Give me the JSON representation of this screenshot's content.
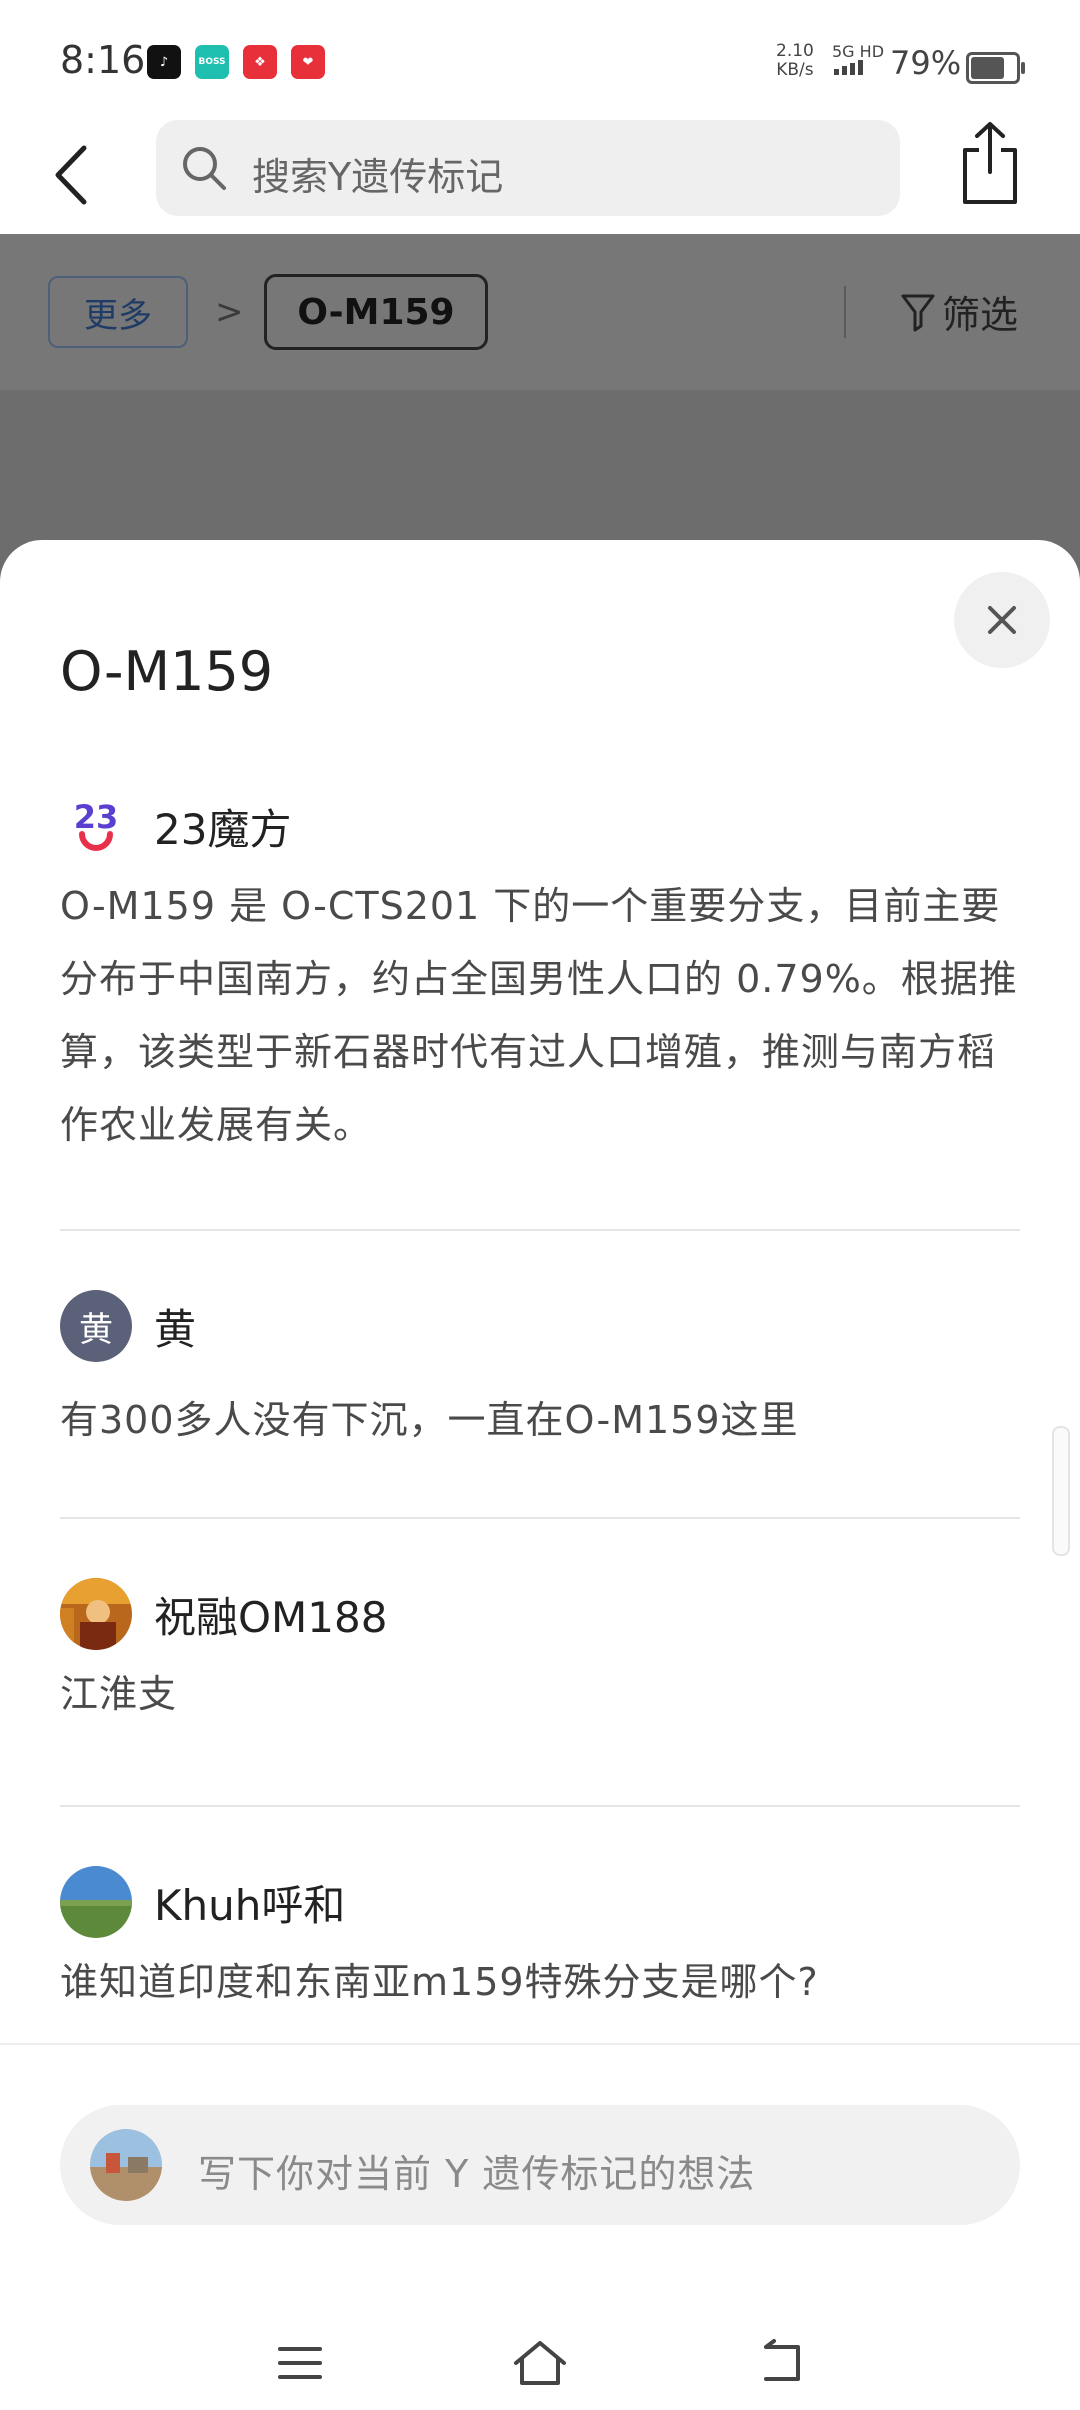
{
  "status_bar": {
    "time": "8:16",
    "app_icons": [
      {
        "name": "tiktok-icon",
        "color": "#111111",
        "label": "♪"
      },
      {
        "name": "boss-icon",
        "color": "#1fbfb0",
        "label": "BOSS"
      },
      {
        "name": "app-red-icon-1",
        "color": "#e8303a",
        "label": "❖"
      },
      {
        "name": "app-red-icon-2",
        "color": "#e8303a",
        "label": "❤"
      }
    ],
    "net_speed": "2.10",
    "net_unit": "KB/s",
    "signal": "5G HD",
    "battery": "79%",
    "battery_level": 0.79
  },
  "nav": {
    "search_placeholder": "搜索Y遗传标记"
  },
  "filter_bar": {
    "more": "更多",
    "separator": ">",
    "current": "O-M159",
    "filter": "筛选"
  },
  "sheet": {
    "title": "O-M159",
    "comments": [
      {
        "user": "23魔方",
        "avatar": "logo-23",
        "text": "O-M159 是 O-CTS201 下的一个重要分支，目前主要分布于中国南方，约占全国男性人口的 0.79%。根据推算，该类型于新石器时代有过人口增殖，推测与南方稻作农业发展有关。"
      },
      {
        "user": "黄",
        "avatar": "initial",
        "avatar_text": "黄",
        "text": "有300多人没有下沉，一直在O-M159这里"
      },
      {
        "user": "祝融OM188",
        "avatar": "photo-temple",
        "text": "江淮支"
      },
      {
        "user": "Khuh呼和",
        "avatar": "photo-grassland",
        "text": "谁知道印度和东南亚m159特殊分支是哪个?"
      }
    ]
  },
  "composer": {
    "placeholder": "写下你对当前 Y 遗传标记的想法"
  },
  "colors": {
    "accent_blue": "#1f3b66",
    "logo_purple": "#5a3fd0",
    "logo_red": "#e8304a"
  }
}
